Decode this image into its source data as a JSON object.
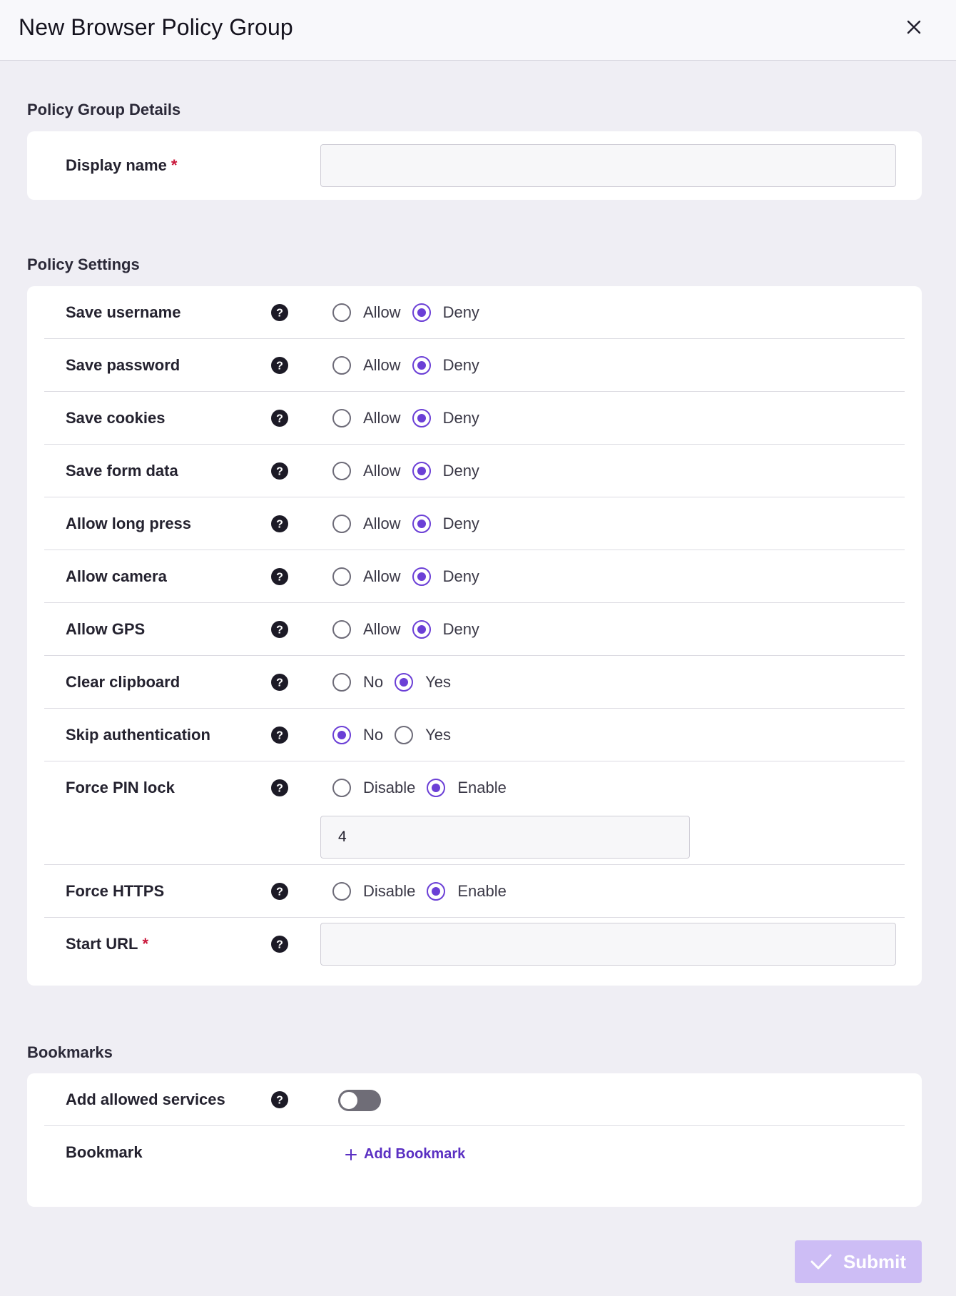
{
  "header": {
    "title": "New Browser Policy Group"
  },
  "details": {
    "section_title": "Policy Group Details",
    "display_name_label": "Display name",
    "required_mark": "*",
    "display_name_value": ""
  },
  "settings": {
    "section_title": "Policy Settings",
    "rows": [
      {
        "label": "Save username",
        "options": [
          "Allow",
          "Deny"
        ],
        "selected": "Deny"
      },
      {
        "label": "Save password",
        "options": [
          "Allow",
          "Deny"
        ],
        "selected": "Deny"
      },
      {
        "label": "Save cookies",
        "options": [
          "Allow",
          "Deny"
        ],
        "selected": "Deny"
      },
      {
        "label": "Save form data",
        "options": [
          "Allow",
          "Deny"
        ],
        "selected": "Deny"
      },
      {
        "label": "Allow long press",
        "options": [
          "Allow",
          "Deny"
        ],
        "selected": "Deny"
      },
      {
        "label": "Allow camera",
        "options": [
          "Allow",
          "Deny"
        ],
        "selected": "Deny"
      },
      {
        "label": "Allow GPS",
        "options": [
          "Allow",
          "Deny"
        ],
        "selected": "Deny"
      },
      {
        "label": "Clear clipboard",
        "options": [
          "No",
          "Yes"
        ],
        "selected": "Yes"
      },
      {
        "label": "Skip authentication",
        "options": [
          "No",
          "Yes"
        ],
        "selected": "No"
      },
      {
        "label": "Force PIN lock",
        "options": [
          "Disable",
          "Enable"
        ],
        "selected": "Enable"
      },
      {
        "label": "Force HTTPS",
        "options": [
          "Disable",
          "Enable"
        ],
        "selected": "Enable"
      }
    ],
    "pin_length_value": "4",
    "start_url_label": "Start URL",
    "start_url_value": ""
  },
  "bookmarks": {
    "section_title": "Bookmarks",
    "add_allowed_services_label": "Add allowed services",
    "add_allowed_services_on": false,
    "bookmark_label": "Bookmark",
    "add_bookmark_label": "Add Bookmark"
  },
  "footer": {
    "submit_label": "Submit"
  },
  "colors": {
    "accent": "#6b3fd6",
    "submit_disabled": "#cdbdf5",
    "required": "#c9183b",
    "background": "#efeef4"
  },
  "icons": {
    "close": "close-icon",
    "help": "help-circle-icon",
    "plus": "plus-icon",
    "check": "check-icon"
  }
}
